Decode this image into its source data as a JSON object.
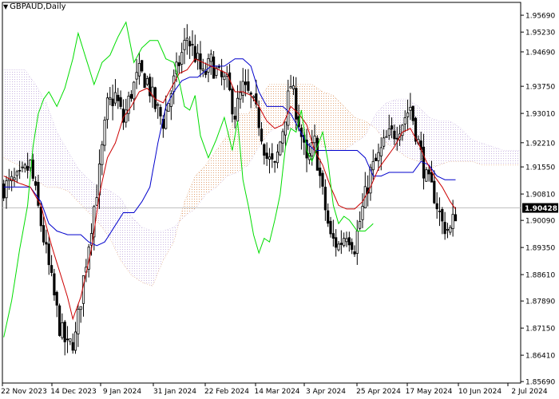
{
  "symbol": "GBPAUD",
  "timeframe": "Daily",
  "colors": {
    "background": "#ffffff",
    "candle": "#000000",
    "tenkan": "#cc0000",
    "kijun": "#0000cc",
    "chikou": "#00dd00",
    "cloud_bull": "#e0a070",
    "cloud_bear": "#c8b4e0",
    "grid": "#c0c0c0",
    "current_label_bg": "#000000",
    "current_label_text": "#ffffff"
  },
  "chart_data": {
    "type": "candlestick",
    "ylim": [
      1.8565,
      1.9604
    ],
    "yticks": [
      "1.95690",
      "1.95230",
      "1.94690",
      "1.93750",
      "1.93010",
      "1.92210",
      "1.91550",
      "1.90810",
      "1.90090",
      "1.89350",
      "1.88610",
      "1.87890",
      "1.87150",
      "1.86410",
      "1.85690"
    ],
    "xticks": [
      "22 Nov 2023",
      "14 Dec 2023",
      "9 Jan 2024",
      "31 Jan 2024",
      "22 Feb 2024",
      "14 Mar 2024",
      "3 Apr 2024",
      "25 Apr 2024",
      "17 May 2024",
      "10 Jun 2024",
      "2 Jul 2024"
    ],
    "current_price": "1.90428",
    "current_value": 1.9043,
    "close_anchors": [
      [
        0,
        1.91
      ],
      [
        6,
        1.912
      ],
      [
        10,
        1.916
      ],
      [
        14,
        1.9
      ],
      [
        18,
        1.884
      ],
      [
        21,
        1.872
      ],
      [
        24,
        1.866
      ],
      [
        27,
        1.869
      ],
      [
        30,
        1.885
      ],
      [
        33,
        1.9
      ],
      [
        36,
        1.914
      ],
      [
        39,
        1.932
      ],
      [
        42,
        1.935
      ],
      [
        45,
        1.928
      ],
      [
        48,
        1.936
      ],
      [
        51,
        1.941
      ],
      [
        54,
        1.939
      ],
      [
        57,
        1.932
      ],
      [
        60,
        1.928
      ],
      [
        63,
        1.936
      ],
      [
        66,
        1.944
      ],
      [
        69,
        1.951
      ],
      [
        72,
        1.946
      ],
      [
        75,
        1.94
      ],
      [
        78,
        1.944
      ],
      [
        81,
        1.94
      ],
      [
        84,
        1.938
      ],
      [
        87,
        1.93
      ],
      [
        90,
        1.937
      ],
      [
        93,
        1.934
      ],
      [
        96,
        1.928
      ],
      [
        99,
        1.918
      ],
      [
        102,
        1.915
      ],
      [
        105,
        1.926
      ],
      [
        108,
        1.938
      ],
      [
        111,
        1.928
      ],
      [
        114,
        1.916
      ],
      [
        117,
        1.922
      ],
      [
        120,
        1.908
      ],
      [
        123,
        1.896
      ],
      [
        126,
        1.894
      ],
      [
        129,
        1.898
      ],
      [
        132,
        1.894
      ],
      [
        135,
        1.904
      ],
      [
        138,
        1.914
      ],
      [
        141,
        1.918
      ],
      [
        144,
        1.923
      ],
      [
        147,
        1.925
      ],
      [
        150,
        1.928
      ],
      [
        153,
        1.932
      ],
      [
        156,
        1.922
      ],
      [
        159,
        1.912
      ],
      [
        162,
        1.908
      ],
      [
        165,
        1.9
      ],
      [
        168,
        1.898
      ],
      [
        170,
        1.903
      ]
    ],
    "tenkan_sen": [
      [
        0,
        1.913
      ],
      [
        6,
        1.911
      ],
      [
        10,
        1.91
      ],
      [
        14,
        1.905
      ],
      [
        18,
        1.894
      ],
      [
        21,
        1.887
      ],
      [
        24,
        1.88
      ],
      [
        26,
        1.874
      ],
      [
        29,
        1.88
      ],
      [
        33,
        1.893
      ],
      [
        36,
        1.908
      ],
      [
        39,
        1.918
      ],
      [
        42,
        1.922
      ],
      [
        45,
        1.929
      ],
      [
        48,
        1.932
      ],
      [
        51,
        1.936
      ],
      [
        54,
        1.937
      ],
      [
        57,
        1.934
      ],
      [
        60,
        1.933
      ],
      [
        63,
        1.937
      ],
      [
        66,
        1.941
      ],
      [
        69,
        1.942
      ],
      [
        72,
        1.945
      ],
      [
        75,
        1.944
      ],
      [
        78,
        1.943
      ],
      [
        81,
        1.942
      ],
      [
        84,
        1.941
      ],
      [
        87,
        1.936
      ],
      [
        90,
        1.936
      ],
      [
        93,
        1.935
      ],
      [
        96,
        1.932
      ],
      [
        99,
        1.928
      ],
      [
        102,
        1.926
      ],
      [
        105,
        1.927
      ],
      [
        108,
        1.932
      ],
      [
        111,
        1.93
      ],
      [
        114,
        1.927
      ],
      [
        117,
        1.92
      ],
      [
        120,
        1.916
      ],
      [
        123,
        1.91
      ],
      [
        126,
        1.905
      ],
      [
        129,
        1.904
      ],
      [
        132,
        1.904
      ],
      [
        135,
        1.906
      ],
      [
        138,
        1.91
      ],
      [
        141,
        1.915
      ],
      [
        144,
        1.918
      ],
      [
        147,
        1.921
      ],
      [
        150,
        1.925
      ],
      [
        153,
        1.926
      ],
      [
        156,
        1.922
      ],
      [
        159,
        1.917
      ],
      [
        162,
        1.913
      ],
      [
        165,
        1.91
      ],
      [
        168,
        1.906
      ],
      [
        170,
        1.904
      ]
    ],
    "kijun_sen": [
      [
        0,
        1.91
      ],
      [
        10,
        1.91
      ],
      [
        14,
        1.906
      ],
      [
        17,
        1.9
      ],
      [
        20,
        1.898
      ],
      [
        24,
        1.897
      ],
      [
        29,
        1.897
      ],
      [
        32,
        1.895
      ],
      [
        35,
        1.894
      ],
      [
        38,
        1.895
      ],
      [
        45,
        1.903
      ],
      [
        49,
        1.903
      ],
      [
        52,
        1.906
      ],
      [
        55,
        1.91
      ],
      [
        58,
        1.922
      ],
      [
        61,
        1.932
      ],
      [
        64,
        1.936
      ],
      [
        67,
        1.939
      ],
      [
        70,
        1.94
      ],
      [
        73,
        1.94
      ],
      [
        78,
        1.943
      ],
      [
        83,
        1.943
      ],
      [
        87,
        1.945
      ],
      [
        90,
        1.945
      ],
      [
        93,
        1.943
      ],
      [
        96,
        1.936
      ],
      [
        99,
        1.932
      ],
      [
        102,
        1.932
      ],
      [
        105,
        1.932
      ],
      [
        108,
        1.93
      ],
      [
        111,
        1.926
      ],
      [
        114,
        1.922
      ],
      [
        117,
        1.92
      ],
      [
        121,
        1.92
      ],
      [
        124,
        1.92
      ],
      [
        127,
        1.92
      ],
      [
        130,
        1.92
      ],
      [
        133,
        1.92
      ],
      [
        136,
        1.918
      ],
      [
        139,
        1.913
      ],
      [
        142,
        1.913
      ],
      [
        145,
        1.914
      ],
      [
        148,
        1.914
      ],
      [
        151,
        1.914
      ],
      [
        154,
        1.914
      ],
      [
        157,
        1.917
      ],
      [
        160,
        1.916
      ],
      [
        163,
        1.913
      ],
      [
        166,
        1.912
      ],
      [
        170,
        1.912
      ]
    ],
    "chikou_span": [
      [
        0,
        1.869
      ],
      [
        3,
        1.879
      ],
      [
        6,
        1.893
      ],
      [
        9,
        1.905
      ],
      [
        11,
        1.921
      ],
      [
        13,
        1.93
      ],
      [
        15,
        1.934
      ],
      [
        17,
        1.936
      ],
      [
        20,
        1.932
      ],
      [
        23,
        1.937
      ],
      [
        26,
        1.945
      ],
      [
        28,
        1.952
      ],
      [
        31,
        1.945
      ],
      [
        34,
        1.938
      ],
      [
        37,
        1.944
      ],
      [
        40,
        1.946
      ],
      [
        43,
        1.951
      ],
      [
        46,
        1.955
      ],
      [
        49,
        1.944
      ],
      [
        52,
        1.948
      ],
      [
        55,
        1.95
      ],
      [
        58,
        1.95
      ],
      [
        61,
        1.945
      ],
      [
        64,
        1.944
      ],
      [
        66,
        1.939
      ],
      [
        68,
        1.932
      ],
      [
        70,
        1.931
      ],
      [
        72,
        1.935
      ],
      [
        74,
        1.924
      ],
      [
        77,
        1.918
      ],
      [
        80,
        1.923
      ],
      [
        83,
        1.929
      ],
      [
        86,
        1.92
      ],
      [
        88,
        1.928
      ],
      [
        90,
        1.912
      ],
      [
        92,
        1.905
      ],
      [
        94,
        1.897
      ],
      [
        96,
        1.892
      ],
      [
        98,
        1.896
      ],
      [
        100,
        1.895
      ],
      [
        102,
        1.901
      ],
      [
        104,
        1.908
      ],
      [
        106,
        1.921
      ],
      [
        108,
        1.926
      ],
      [
        110,
        1.925
      ],
      [
        112,
        1.931
      ],
      [
        114,
        1.92
      ],
      [
        116,
        1.917
      ],
      [
        118,
        1.921
      ],
      [
        120,
        1.925
      ],
      [
        122,
        1.917
      ],
      [
        124,
        1.905
      ],
      [
        126,
        1.9
      ],
      [
        128,
        1.902
      ],
      [
        130,
        1.901
      ],
      [
        133,
        1.898
      ],
      [
        136,
        1.898
      ],
      [
        139,
        1.9
      ]
    ],
    "senkou_span_a": [
      [
        0,
        1.918
      ],
      [
        8,
        1.915
      ],
      [
        12,
        1.912
      ],
      [
        16,
        1.91
      ],
      [
        20,
        1.91
      ],
      [
        24,
        1.909
      ],
      [
        28,
        1.906
      ],
      [
        32,
        1.903
      ],
      [
        36,
        1.9
      ],
      [
        40,
        1.896
      ],
      [
        44,
        1.89
      ],
      [
        48,
        1.886
      ],
      [
        52,
        1.884
      ],
      [
        56,
        1.883
      ],
      [
        60,
        1.89
      ],
      [
        64,
        1.895
      ],
      [
        68,
        1.906
      ],
      [
        72,
        1.913
      ],
      [
        76,
        1.916
      ],
      [
        80,
        1.92
      ],
      [
        84,
        1.924
      ],
      [
        88,
        1.93
      ],
      [
        92,
        1.93
      ],
      [
        96,
        1.934
      ],
      [
        100,
        1.938
      ],
      [
        104,
        1.938
      ],
      [
        108,
        1.938
      ],
      [
        112,
        1.938
      ],
      [
        116,
        1.938
      ],
      [
        120,
        1.936
      ],
      [
        124,
        1.935
      ],
      [
        128,
        1.932
      ],
      [
        132,
        1.929
      ],
      [
        136,
        1.928
      ],
      [
        140,
        1.926
      ],
      [
        144,
        1.922
      ],
      [
        148,
        1.92
      ],
      [
        152,
        1.918
      ],
      [
        156,
        1.917
      ],
      [
        160,
        1.915
      ],
      [
        164,
        1.916
      ],
      [
        168,
        1.917
      ],
      [
        172,
        1.917
      ],
      [
        176,
        1.917
      ],
      [
        180,
        1.916
      ],
      [
        184,
        1.916
      ],
      [
        188,
        1.916
      ],
      [
        192,
        1.916
      ]
    ],
    "senkou_span_b": [
      [
        0,
        1.942
      ],
      [
        8,
        1.942
      ],
      [
        12,
        1.938
      ],
      [
        16,
        1.933
      ],
      [
        20,
        1.925
      ],
      [
        24,
        1.92
      ],
      [
        28,
        1.915
      ],
      [
        32,
        1.912
      ],
      [
        36,
        1.91
      ],
      [
        40,
        1.909
      ],
      [
        44,
        1.907
      ],
      [
        48,
        1.902
      ],
      [
        52,
        1.899
      ],
      [
        56,
        1.898
      ],
      [
        60,
        1.898
      ],
      [
        64,
        1.899
      ],
      [
        68,
        1.902
      ],
      [
        72,
        1.904
      ],
      [
        76,
        1.908
      ],
      [
        80,
        1.91
      ],
      [
        84,
        1.913
      ],
      [
        88,
        1.914
      ],
      [
        92,
        1.916
      ],
      [
        96,
        1.921
      ],
      [
        100,
        1.925
      ],
      [
        104,
        1.927
      ],
      [
        108,
        1.926
      ],
      [
        112,
        1.926
      ],
      [
        116,
        1.922
      ],
      [
        120,
        1.921
      ],
      [
        124,
        1.92
      ],
      [
        128,
        1.92
      ],
      [
        132,
        1.922
      ],
      [
        136,
        1.924
      ],
      [
        140,
        1.93
      ],
      [
        144,
        1.933
      ],
      [
        148,
        1.934
      ],
      [
        152,
        1.934
      ],
      [
        156,
        1.932
      ],
      [
        160,
        1.929
      ],
      [
        164,
        1.928
      ],
      [
        168,
        1.928
      ],
      [
        172,
        1.926
      ],
      [
        176,
        1.923
      ],
      [
        180,
        1.922
      ],
      [
        184,
        1.921
      ],
      [
        188,
        1.92
      ],
      [
        192,
        1.92
      ]
    ]
  }
}
